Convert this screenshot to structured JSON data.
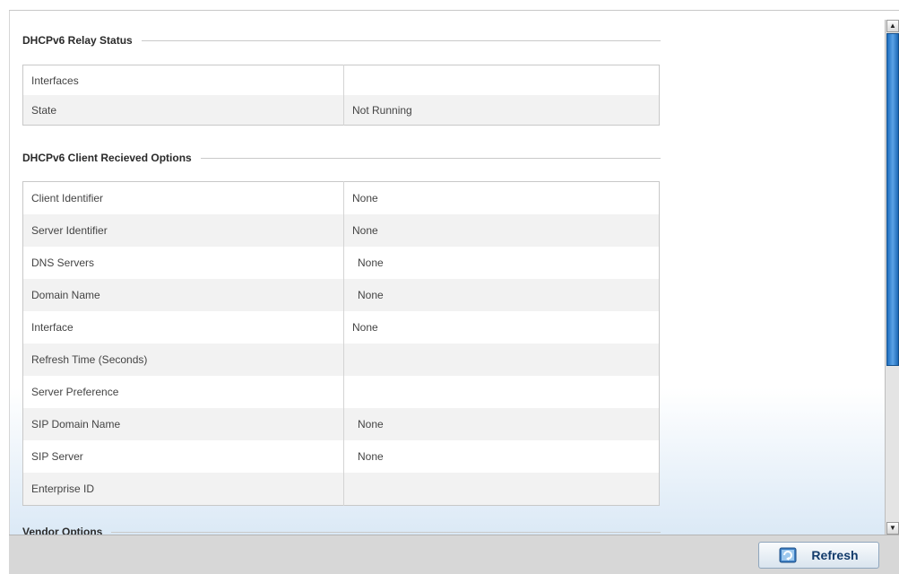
{
  "relay_status": {
    "title": "DHCPv6 Relay Status",
    "rows": [
      {
        "label": "Interfaces",
        "value": ""
      },
      {
        "label": "State",
        "value": "Not Running"
      }
    ]
  },
  "client_options": {
    "title": "DHCPv6 Client Recieved Options",
    "rows": [
      {
        "label": "Client Identifier",
        "value": "None"
      },
      {
        "label": "Server Identifier",
        "value": "None"
      },
      {
        "label": "DNS Servers",
        "value": "None"
      },
      {
        "label": "Domain Name",
        "value": "None"
      },
      {
        "label": "Interface",
        "value": "None"
      },
      {
        "label": "Refresh Time (Seconds)",
        "value": ""
      },
      {
        "label": "Server Preference",
        "value": ""
      },
      {
        "label": "SIP Domain Name",
        "value": "None"
      },
      {
        "label": "SIP Server",
        "value": "None"
      },
      {
        "label": "Enterprise ID",
        "value": ""
      }
    ]
  },
  "vendor_options": {
    "title": "Vendor Options"
  },
  "footer": {
    "refresh_label": "Refresh",
    "refresh_icon": "refresh-icon"
  },
  "scrollbar": {
    "up_glyph": "▲",
    "down_glyph": "▼"
  }
}
